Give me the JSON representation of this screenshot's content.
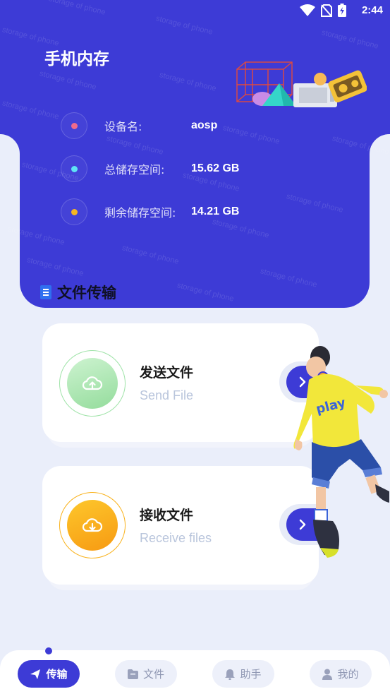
{
  "status_bar": {
    "time": "2:44"
  },
  "header": {
    "title": "手机内存"
  },
  "watermark_text": "storage of phone",
  "device_info": [
    {
      "label": "设备名:",
      "value": "aosp",
      "dot_color": "#f06b8c"
    },
    {
      "label": "总储存空间:",
      "value": "15.62 GB",
      "dot_color": "#5fe3f5"
    },
    {
      "label": "剩余储存空间:",
      "value": "14.21 GB",
      "dot_color": "#f5b623"
    }
  ],
  "section": {
    "title": "文件传输"
  },
  "cards": [
    {
      "title": "发送文件",
      "subtitle": "Send File",
      "icon": "cloud-upload-icon"
    },
    {
      "title": "接收文件",
      "subtitle": "Receive files",
      "icon": "cloud-download-icon"
    }
  ],
  "bottom_nav": [
    {
      "label": "传输",
      "icon": "send-icon",
      "active": true
    },
    {
      "label": "文件",
      "icon": "folder-icon",
      "active": false
    },
    {
      "label": "助手",
      "icon": "bell-icon",
      "active": false
    },
    {
      "label": "我的",
      "icon": "user-icon",
      "active": false
    }
  ],
  "colors": {
    "primary": "#3d3bd6",
    "background": "#eaeefa",
    "send_green": "#9fe3a8",
    "receive_orange": "#f9a91a"
  }
}
